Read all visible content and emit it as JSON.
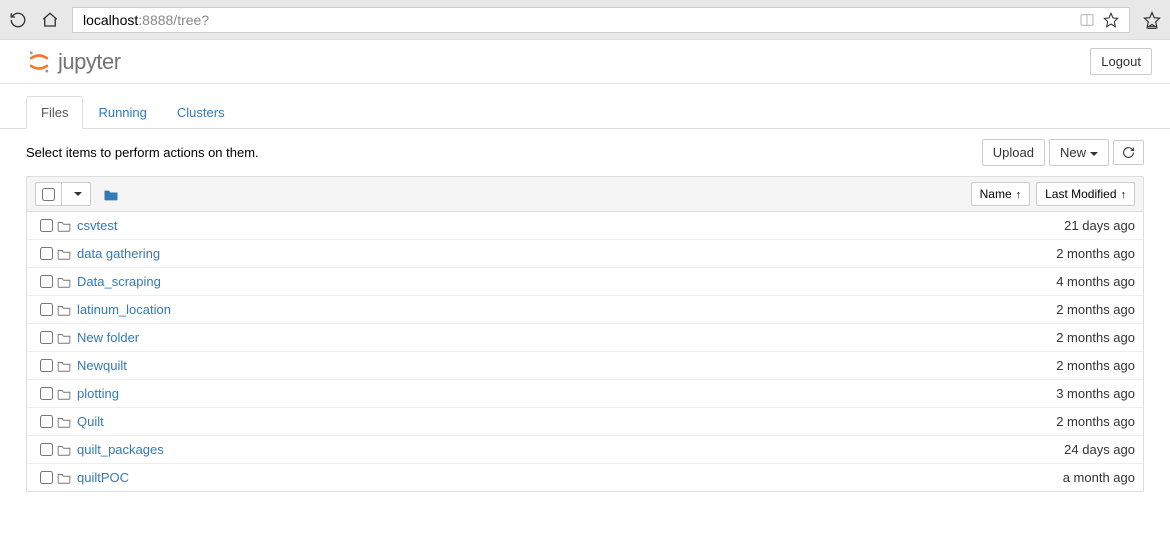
{
  "browser": {
    "url_domain": "localhost",
    "url_path": ":8888/tree?"
  },
  "header": {
    "brand": "jupyter",
    "logout": "Logout"
  },
  "tabs": {
    "files": "Files",
    "running": "Running",
    "clusters": "Clusters"
  },
  "actions": {
    "hint": "Select items to perform actions on them.",
    "upload": "Upload",
    "new": "New"
  },
  "columns": {
    "name": "Name",
    "modified": "Last Modified"
  },
  "items": [
    {
      "name": "csvtest",
      "modified": "21 days ago"
    },
    {
      "name": "data gathering",
      "modified": "2 months ago"
    },
    {
      "name": "Data_scraping",
      "modified": "4 months ago"
    },
    {
      "name": "latinum_location",
      "modified": "2 months ago"
    },
    {
      "name": "New folder",
      "modified": "2 months ago"
    },
    {
      "name": "Newquilt",
      "modified": "2 months ago"
    },
    {
      "name": "plotting",
      "modified": "3 months ago"
    },
    {
      "name": "Quilt",
      "modified": "2 months ago"
    },
    {
      "name": "quilt_packages",
      "modified": "24 days ago"
    },
    {
      "name": "quiltPOC",
      "modified": "a month ago"
    }
  ]
}
